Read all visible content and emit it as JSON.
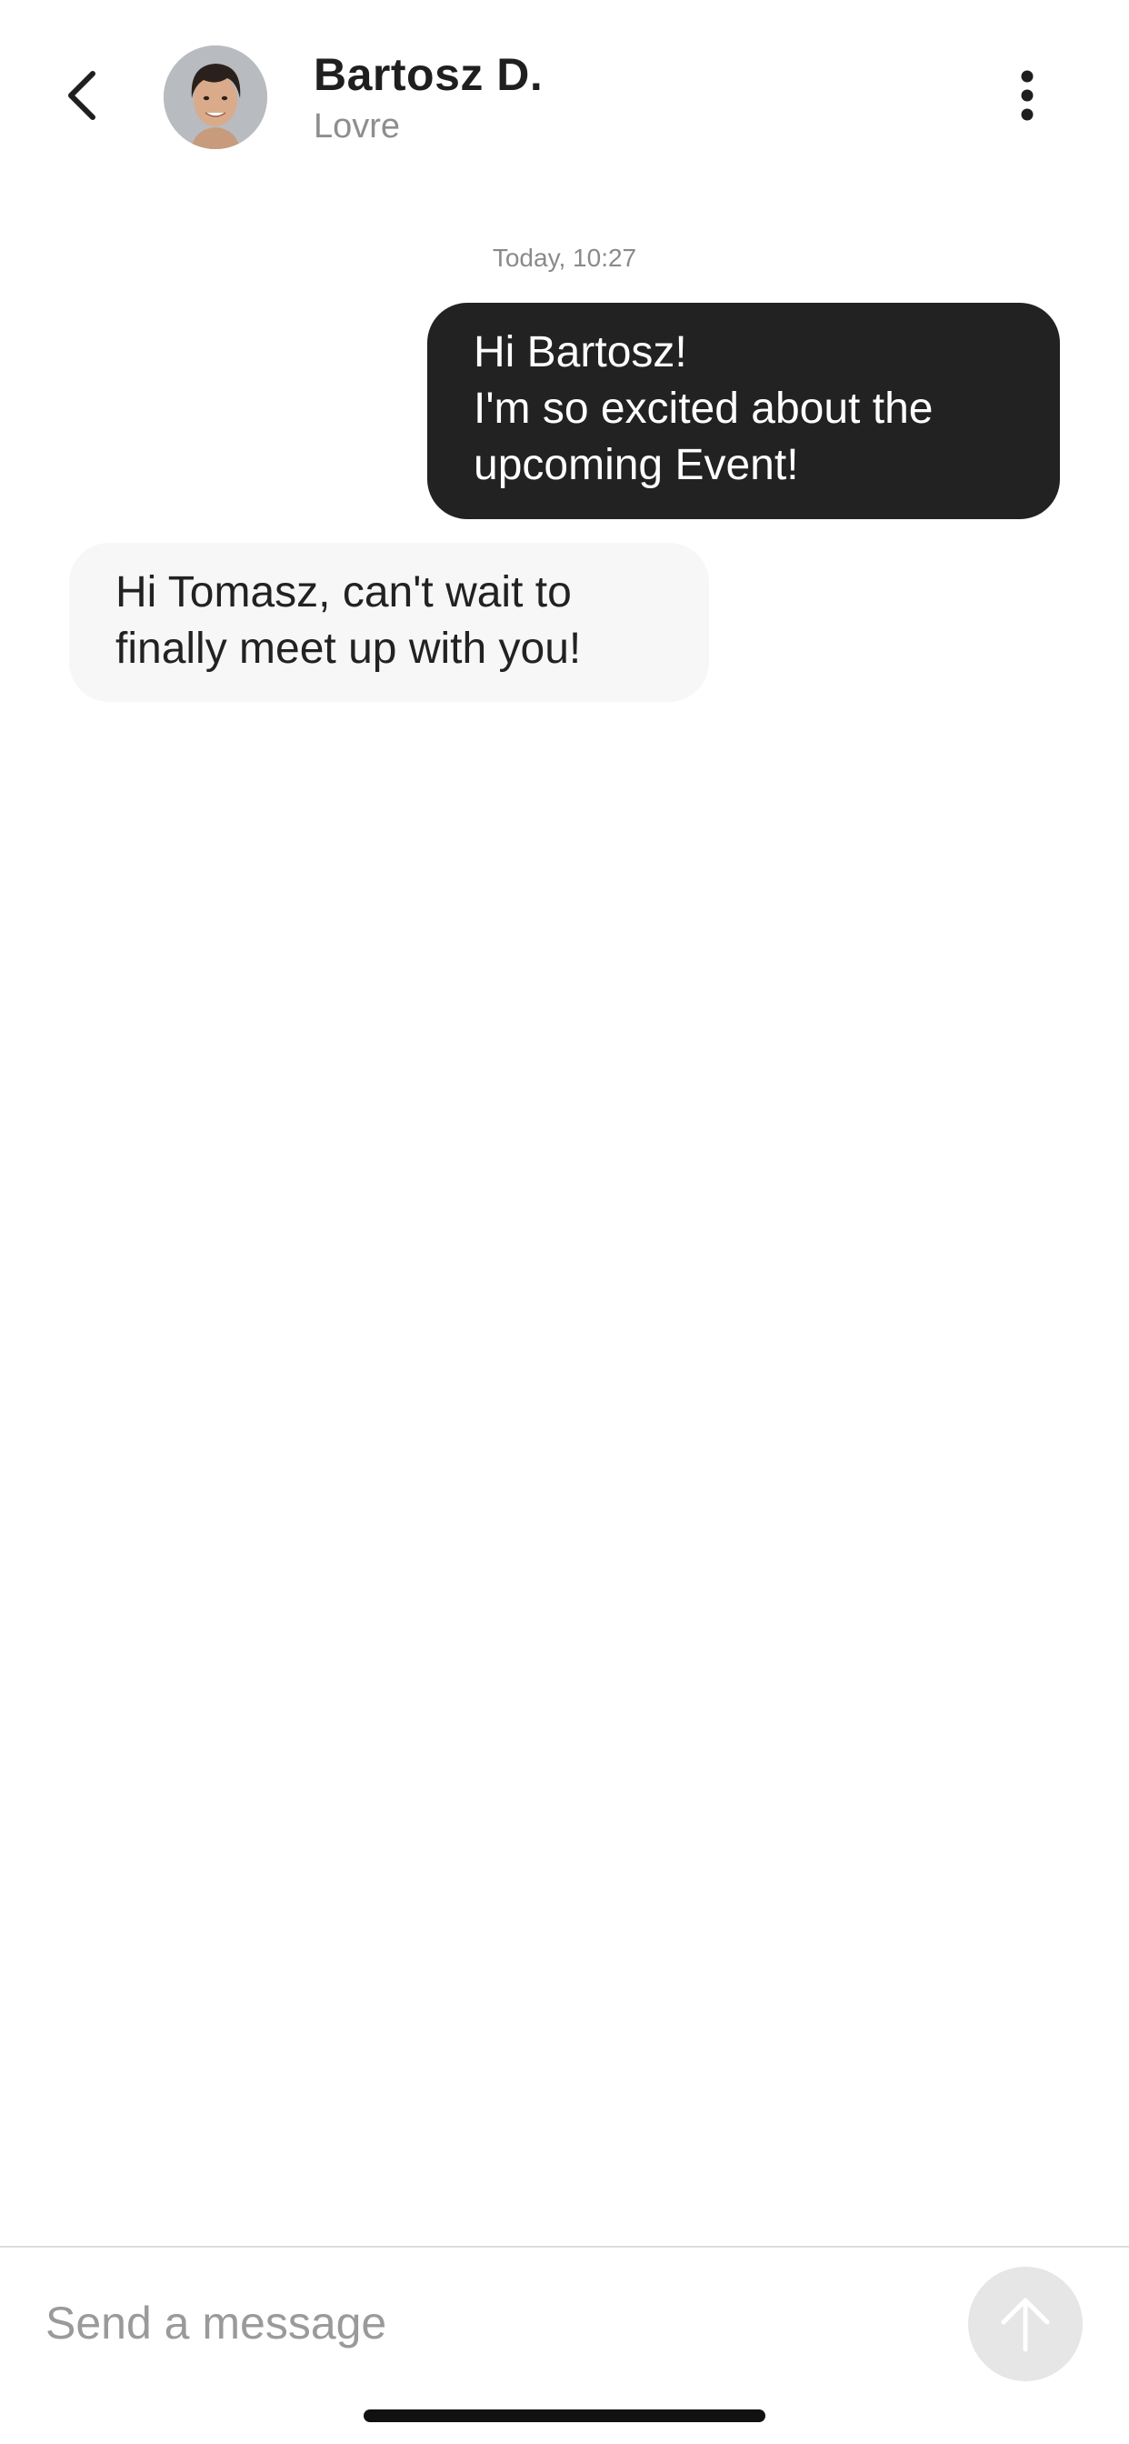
{
  "header": {
    "contact_name": "Bartosz D.",
    "contact_subtitle": "Lovre",
    "back_icon": "chevron-left-icon",
    "more_icon": "more-vertical-icon"
  },
  "conversation": {
    "timestamp": "Today, 10:27",
    "messages": [
      {
        "direction": "outgoing",
        "text": "Hi Bartosz!\nI'm so excited about the\nupcoming Event!"
      },
      {
        "direction": "incoming",
        "text": "Hi Tomasz, can't wait to\nfinally meet up with you!"
      }
    ]
  },
  "composer": {
    "value": "",
    "placeholder": "Send a message",
    "send_icon": "arrow-up-icon"
  },
  "colors": {
    "outgoing_bubble": "#222222",
    "incoming_bubble": "#f7f7f7",
    "send_button_disabled": "#e6e6e6",
    "muted_text": "#8e8e8e"
  }
}
